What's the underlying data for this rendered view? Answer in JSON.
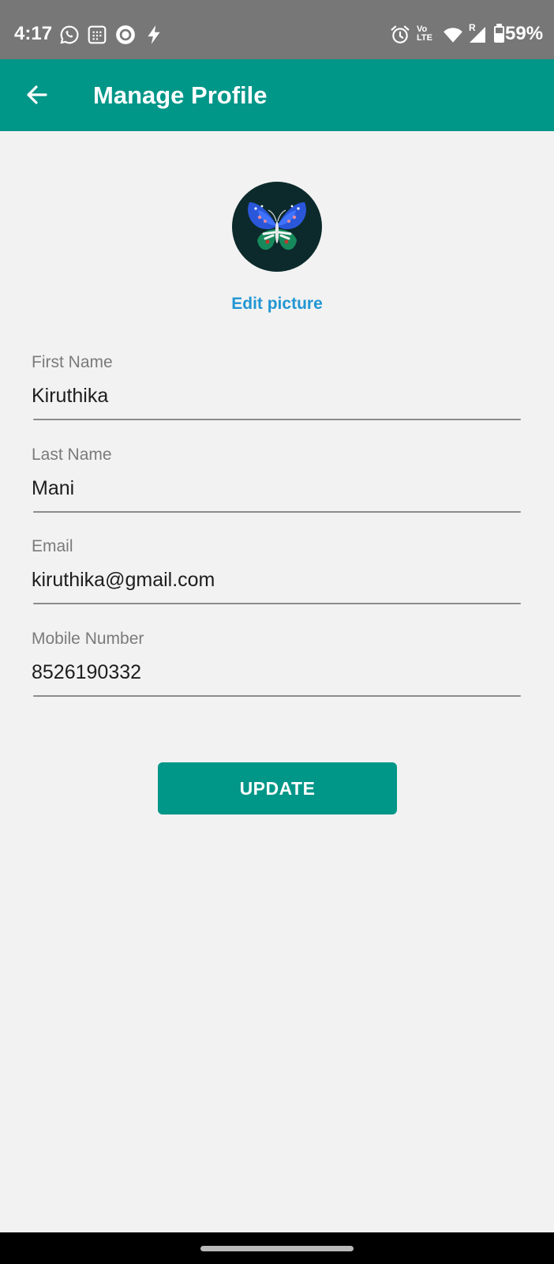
{
  "status_bar": {
    "time": "4:17",
    "left_icons": [
      "whatsapp-icon",
      "calendar-app-icon",
      "circle-app-icon",
      "flash-icon"
    ],
    "right_icons": [
      "alarm-icon",
      "volte-icon",
      "wifi-icon",
      "signal-roaming-icon",
      "battery-icon"
    ],
    "network_label_top": "Vo",
    "network_label_bottom": "LTE",
    "roaming_label": "R",
    "battery_percent": "59%",
    "battery_level": 0.59
  },
  "app_bar": {
    "title": "Manage Profile",
    "back_icon": "arrow-left-icon",
    "color": "#009688"
  },
  "profile": {
    "avatar_icon": "butterfly-image",
    "edit_label": "Edit picture",
    "edit_color": "#2196d3"
  },
  "form": {
    "first_name": {
      "label": "First Name",
      "value": "Kiruthika"
    },
    "last_name": {
      "label": "Last Name",
      "value": "Mani"
    },
    "email": {
      "label": "Email",
      "value": "kiruthika@gmail.com"
    },
    "mobile": {
      "label": "Mobile Number",
      "value": "8526190332"
    }
  },
  "update_button": {
    "label": "UPDATE",
    "color": "#009688"
  }
}
